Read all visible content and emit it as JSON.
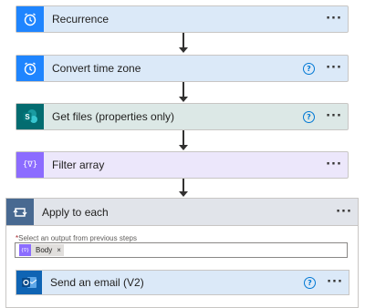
{
  "steps": [
    {
      "title": "Recurrence",
      "icon": "alarm-clock-icon",
      "color": "#1f85ff",
      "help": false
    },
    {
      "title": "Convert time zone",
      "icon": "alarm-clock-icon",
      "color": "#1f85ff",
      "help": true
    },
    {
      "title": "Get files (properties only)",
      "icon": "sharepoint-icon",
      "icon_text": "S",
      "color": "#036c70",
      "help": true
    },
    {
      "title": "Filter array",
      "icon": "filter-array-icon",
      "icon_text": "{∇}",
      "color": "#8c6cff",
      "help": false
    }
  ],
  "more_glyph": "···",
  "help_glyph": "?",
  "apply_to_each": {
    "title": "Apply to each",
    "icon": "loop-icon",
    "color": "#486991",
    "required_mark": "*",
    "field_label": "Select an output from previous steps",
    "token": {
      "label": "Body",
      "remove": "×",
      "icon_text": "{∇}"
    },
    "inner_step": {
      "title": "Send an email (V2)",
      "icon": "outlook-icon",
      "color": "#0f64b4",
      "help": true
    }
  }
}
